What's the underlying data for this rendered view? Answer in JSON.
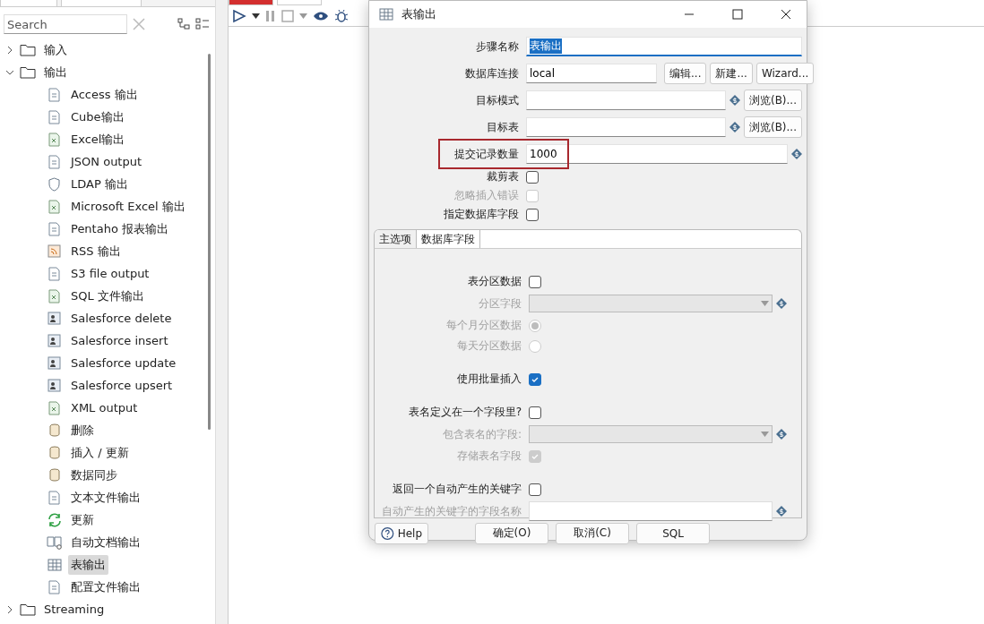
{
  "sidebar": {
    "search": {
      "placeholder": "Search"
    },
    "tree": [
      {
        "label": "输入",
        "expanded": false
      },
      {
        "label": "输出",
        "expanded": true,
        "children": [
          {
            "label": "Access 输出",
            "kind": "doc",
            "selected": false
          },
          {
            "label": "Cube输出",
            "kind": "doc",
            "selected": false
          },
          {
            "label": "Excel输出",
            "kind": "sheet",
            "selected": false
          },
          {
            "label": "JSON output",
            "kind": "doc",
            "selected": false
          },
          {
            "label": "LDAP 输出",
            "kind": "shield",
            "selected": false
          },
          {
            "label": "Microsoft Excel 输出",
            "kind": "sheet",
            "selected": false
          },
          {
            "label": "Pentaho 报表输出",
            "kind": "doc",
            "selected": false
          },
          {
            "label": "RSS 输出",
            "kind": "rss",
            "selected": false
          },
          {
            "label": "S3 file output",
            "kind": "doc",
            "selected": false
          },
          {
            "label": "SQL 文件输出",
            "kind": "sheet",
            "selected": false
          },
          {
            "label": "Salesforce delete",
            "kind": "person",
            "selected": false
          },
          {
            "label": "Salesforce insert",
            "kind": "person",
            "selected": false
          },
          {
            "label": "Salesforce update",
            "kind": "person",
            "selected": false
          },
          {
            "label": "Salesforce upsert",
            "kind": "person",
            "selected": false
          },
          {
            "label": "XML output",
            "kind": "sheet",
            "selected": false
          },
          {
            "label": "删除",
            "kind": "db",
            "selected": false
          },
          {
            "label": "插入 / 更新",
            "kind": "db",
            "selected": false
          },
          {
            "label": "数据同步",
            "kind": "db",
            "selected": false
          },
          {
            "label": "文本文件输出",
            "kind": "doc",
            "selected": false
          },
          {
            "label": "更新",
            "kind": "refresh",
            "selected": false
          },
          {
            "label": "自动文档输出",
            "kind": "book",
            "selected": false
          },
          {
            "label": "表输出",
            "kind": "table",
            "selected": true
          },
          {
            "label": "配置文件输出",
            "kind": "doc",
            "selected": false
          }
        ]
      },
      {
        "label": "Streaming",
        "expanded": false
      }
    ]
  },
  "dialog": {
    "title": "表输出",
    "fields": [
      {
        "label": "步骤名称",
        "value": "表输出",
        "kind": "name"
      },
      {
        "label": "数据库连接",
        "value": "local",
        "kind": "connection",
        "buttons": [
          "编辑...",
          "新建...",
          "Wizard..."
        ]
      },
      {
        "label": "目标模式",
        "kind": "browse",
        "buttons": [
          "浏览(B)..."
        ]
      },
      {
        "label": "目标表",
        "kind": "browse",
        "buttons": [
          "浏览(B)..."
        ]
      },
      {
        "label": "提交记录数量",
        "value": "1000",
        "kind": "variable",
        "highlighted": true
      }
    ],
    "options": [
      {
        "label": "裁剪表",
        "checked": false,
        "disabled": false
      },
      {
        "label": "忽略插入错误",
        "checked": false,
        "disabled": true
      },
      {
        "label": "指定数据库字段",
        "checked": false,
        "disabled": false
      }
    ],
    "tabs": [
      {
        "label": "主选项",
        "selected": true
      },
      {
        "label": "数据库字段",
        "selected": false
      }
    ],
    "groups": [
      [
        {
          "kind": "checkbox",
          "label": "表分区数据",
          "checked": false,
          "disabled": false
        },
        {
          "kind": "combo",
          "label": "分区字段",
          "disabled": true
        },
        {
          "kind": "radio",
          "label": "每个月分区数据",
          "selected": true,
          "disabled": true
        },
        {
          "kind": "radio",
          "label": "每天分区数据",
          "selected": false,
          "disabled": true
        }
      ],
      [
        {
          "kind": "checkbox",
          "label": "使用批量插入",
          "checked": true,
          "disabled": false
        }
      ],
      [
        {
          "kind": "checkbox",
          "label": "表名定义在一个字段里?",
          "checked": false,
          "disabled": false
        },
        {
          "kind": "combo",
          "label": "包含表名的字段:",
          "disabled": true
        },
        {
          "kind": "checkbox",
          "label": "存储表名字段",
          "checked": true,
          "disabled": true
        }
      ],
      [
        {
          "kind": "checkbox",
          "label": "返回一个自动产生的关键字",
          "checked": false,
          "disabled": false
        },
        {
          "kind": "text",
          "label": "自动产生的关键字的字段名称",
          "disabled": true
        }
      ]
    ],
    "buttons": [
      {
        "label": "Help",
        "kind": "help"
      },
      {
        "label": "确定(O)",
        "kind": "plain"
      },
      {
        "label": "取消(C)",
        "kind": "plain"
      },
      {
        "label": "SQL",
        "kind": "plain"
      }
    ]
  }
}
